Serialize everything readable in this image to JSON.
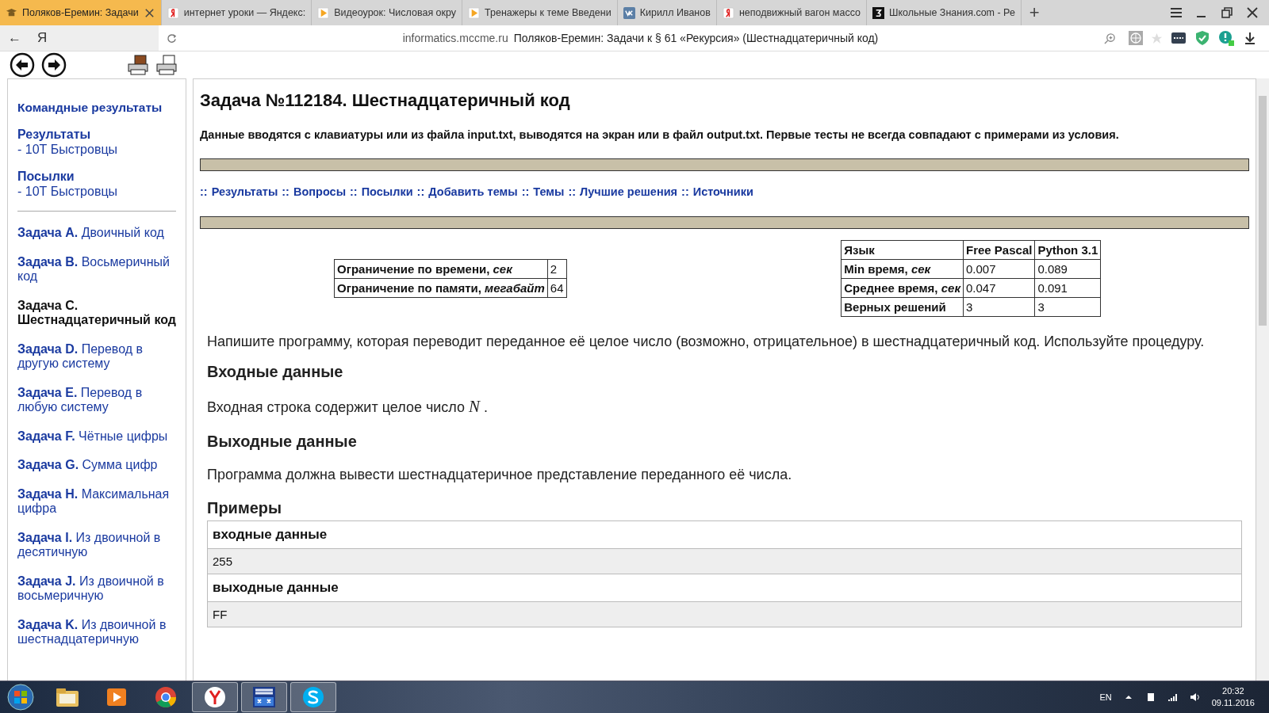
{
  "browser": {
    "tabs": [
      {
        "title": "Поляков-Еремин: Задачи",
        "kind": "site",
        "selected": true
      },
      {
        "title": "интернет уроки — Яндекс:",
        "kind": "yandex",
        "selected": false
      },
      {
        "title": "Видеоурок: Числовая окру",
        "kind": "video",
        "selected": false
      },
      {
        "title": "Тренажеры к теме Введени",
        "kind": "video",
        "selected": false
      },
      {
        "title": "Кирилл Иванов",
        "kind": "vk",
        "selected": false
      },
      {
        "title": "неподвижный вагон массо",
        "kind": "yandex",
        "selected": false
      },
      {
        "title": "Школьные Знания.com - Ре",
        "kind": "znanija",
        "selected": false
      }
    ],
    "new_tab": "+",
    "back": "←",
    "logo": "Я",
    "address": {
      "domain": "informatics.mccme.ru",
      "title": "Поляков-Еремин: Задачи к § 61 «Рекурсия» (Шестнадцатеричный код)"
    }
  },
  "sidebar": {
    "top_links": [
      {
        "label": "Командные результаты"
      },
      {
        "label": "Результаты",
        "sub": "- 10Т Быстровцы"
      },
      {
        "label": "Посылки",
        "sub": "- 10Т Быстровцы"
      }
    ],
    "problems": [
      {
        "label": "Задача A.",
        "title": "Двоичный код",
        "selected": false
      },
      {
        "label": "Задача B.",
        "title": "Восьмеричный код",
        "selected": false
      },
      {
        "label": "Задача C.",
        "title": "Шестнадцатеричный код",
        "selected": true
      },
      {
        "label": "Задача D.",
        "title": "Перевод в другую систему",
        "selected": false
      },
      {
        "label": "Задача E.",
        "title": "Перевод в любую систему",
        "selected": false
      },
      {
        "label": "Задача F.",
        "title": "Чётные цифры",
        "selected": false
      },
      {
        "label": "Задача G.",
        "title": "Сумма цифр",
        "selected": false
      },
      {
        "label": "Задача H.",
        "title": "Максимальная цифра",
        "selected": false
      },
      {
        "label": "Задача I.",
        "title": "Из двоичной в десятичную",
        "selected": false
      },
      {
        "label": "Задача J.",
        "title": "Из двоичной в восьмеричную",
        "selected": false
      },
      {
        "label": "Задача K.",
        "title": "Из двоичной в шестнадцатеричную",
        "selected": false
      }
    ]
  },
  "main": {
    "title": "Задача №112184. Шестнадцатеричный код",
    "note": "Данные вводятся с клавиатуры или из файла input.txt, выводятся на экран или в файл output.txt. Первые тесты не всегда совпадают с примерами из условия.",
    "links": [
      "Результаты",
      "Вопросы",
      "Посылки",
      "Добавить темы",
      "Темы",
      "Лучшие решения",
      "Источники"
    ],
    "link_separator": "::",
    "limits": [
      {
        "label": "Ограничение по времени,",
        "unit": "сек",
        "value": "2"
      },
      {
        "label": "Ограничение по памяти,",
        "unit": "мегабайт",
        "value": "64"
      }
    ],
    "stats": {
      "columns": [
        "Язык",
        "Free Pascal",
        "Python 3.1"
      ],
      "rows": [
        {
          "label": "Min время,",
          "unit": "сек",
          "values": [
            "0.007",
            "0.089"
          ]
        },
        {
          "label": "Среднее время,",
          "unit": "сек",
          "values": [
            "0.047",
            "0.091"
          ]
        },
        {
          "label": "Верных решений",
          "values": [
            "3",
            "3"
          ]
        }
      ]
    },
    "statement": "Напишите программу, которая переводит переданное её целое число (возможно, отрицательное) в шестнадцатеричный код. Используйте процедуру.",
    "sections": [
      {
        "heading": "Входные данные",
        "text": "Входная строка содержит целое число *N* ."
      },
      {
        "heading": "Выходные данные",
        "text": "Программа должна вывести шестнадцатеричное представление переданного её числа."
      }
    ],
    "examples_heading": "Примеры",
    "examples": [
      {
        "label": "входные данные",
        "value": "255"
      },
      {
        "label": "выходные данные",
        "value": "FF"
      }
    ]
  },
  "taskbar": {
    "apps": [
      {
        "kind": "explorer",
        "running": false
      },
      {
        "kind": "player",
        "running": false
      },
      {
        "kind": "chrome",
        "running": false
      },
      {
        "kind": "yandex",
        "running": true
      },
      {
        "kind": "dev",
        "running": true
      },
      {
        "kind": "skype",
        "running": true
      }
    ],
    "lang": "EN",
    "time": "20:32",
    "date": "09.11.2016"
  }
}
